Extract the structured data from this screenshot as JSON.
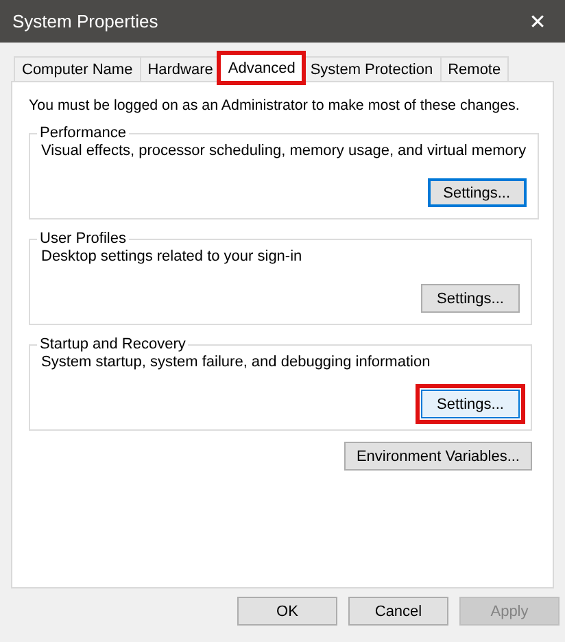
{
  "window": {
    "title": "System Properties",
    "close": "✕"
  },
  "tabs": [
    {
      "label": "Computer Name",
      "selected": false,
      "highlighted": false
    },
    {
      "label": "Hardware",
      "selected": false,
      "highlighted": false
    },
    {
      "label": "Advanced",
      "selected": true,
      "highlighted": true
    },
    {
      "label": "System Protection",
      "selected": false,
      "highlighted": false
    },
    {
      "label": "Remote",
      "selected": false,
      "highlighted": false
    }
  ],
  "notice": "You must be logged on as an Administrator to make most of these changes.",
  "groups": [
    {
      "title": "Performance",
      "description": "Visual effects, processor scheduling, memory usage, and virtual memory",
      "button": {
        "label": "Settings...",
        "focused": true,
        "highlighted": false
      }
    },
    {
      "title": "User Profiles",
      "description": "Desktop settings related to your sign-in",
      "button": {
        "label": "Settings...",
        "focused": false,
        "highlighted": false
      }
    },
    {
      "title": "Startup and Recovery",
      "description": "System startup, system failure, and debugging information",
      "button": {
        "label": "Settings...",
        "focused": false,
        "highlighted": true
      }
    }
  ],
  "environment_button": "Environment Variables...",
  "buttons": [
    {
      "label": "OK",
      "disabled": false
    },
    {
      "label": "Cancel",
      "disabled": false
    },
    {
      "label": "Apply",
      "disabled": true
    }
  ]
}
